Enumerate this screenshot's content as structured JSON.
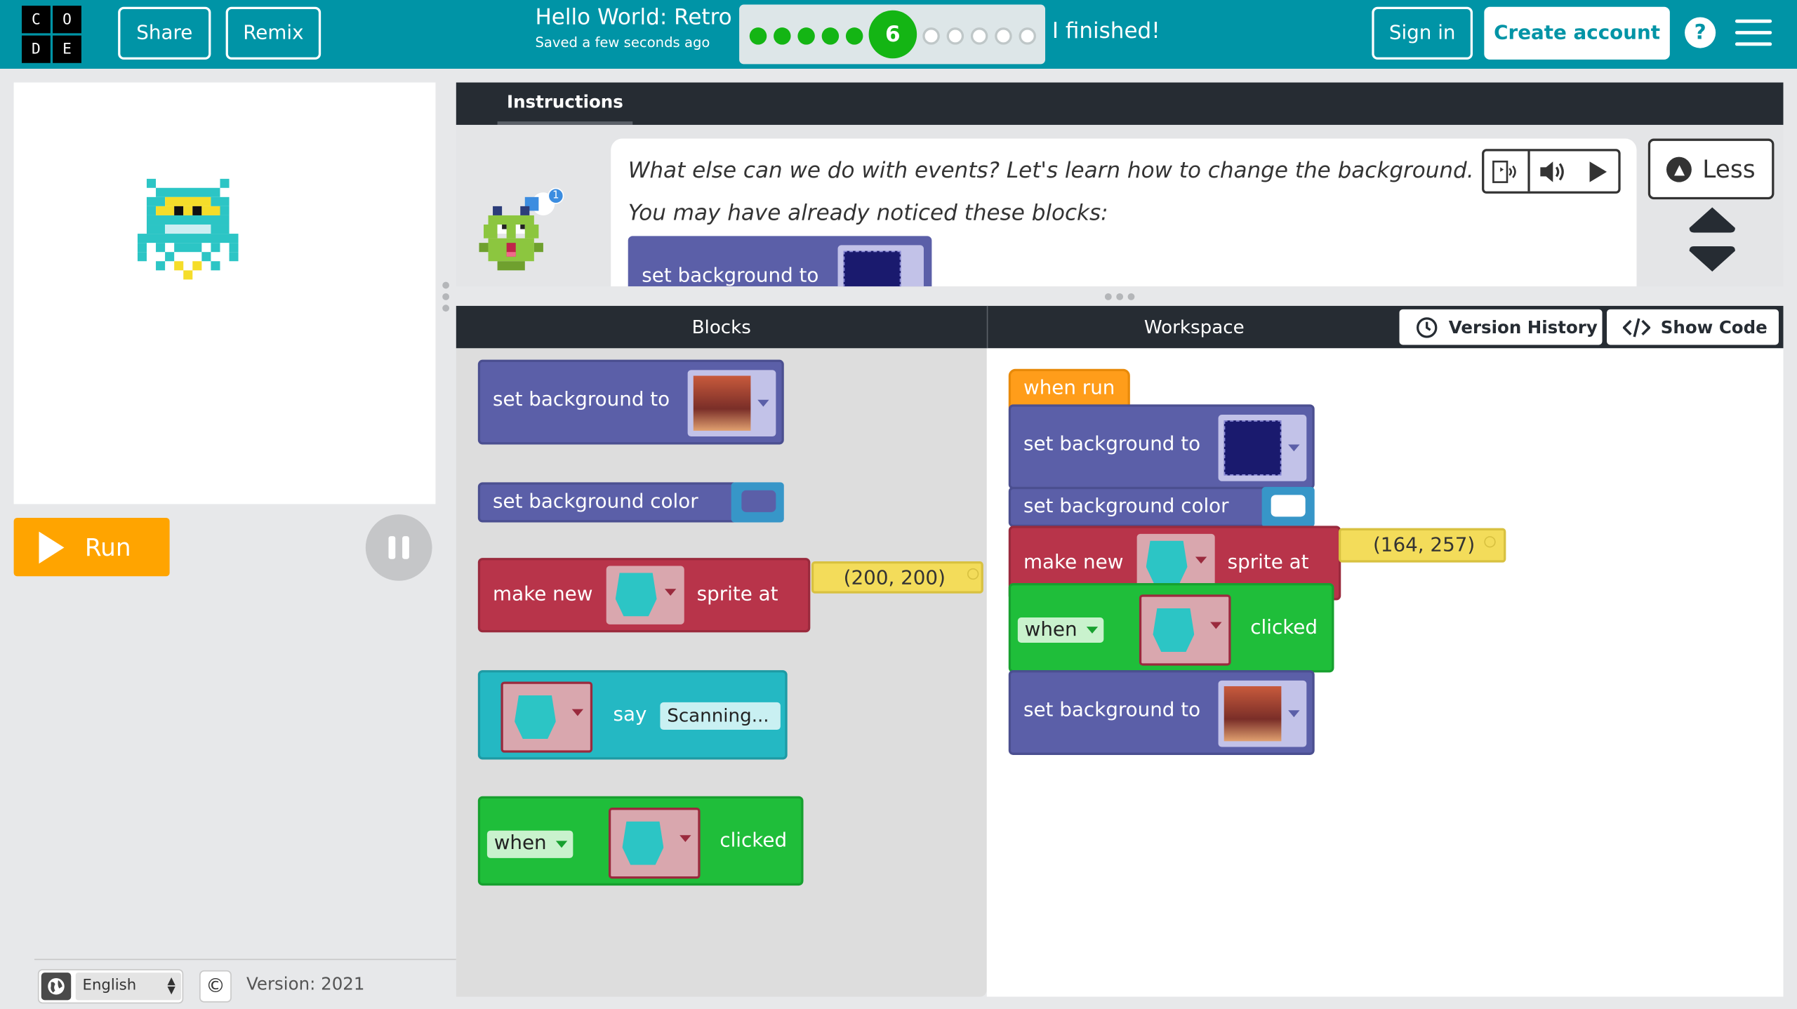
{
  "logo": {
    "letters": [
      "C",
      "O",
      "D",
      "E"
    ]
  },
  "header": {
    "share": "Share",
    "remix": "Remix",
    "title": "Hello World: Retro",
    "subtitle": "Saved a few seconds ago",
    "current_level": "6",
    "levels_done": 5,
    "levels_remaining": 5,
    "finished": "I finished!",
    "sign_in": "Sign in",
    "create_account": "Create account",
    "help": "?"
  },
  "left": {
    "run": "Run",
    "language": "English",
    "version": "Version: 2021",
    "copyright": "©"
  },
  "instructions": {
    "tab": "Instructions",
    "line1": "What else can we do with events? Let's learn how to change the background.",
    "line2": "You may have already noticed these blocks:",
    "block_preview": "set background to",
    "less": "Less",
    "badge": "1"
  },
  "panels": {
    "blocks": "Blocks",
    "workspace": "Workspace",
    "version_history": "Version History",
    "show_code": "Show Code"
  },
  "toolbox": {
    "b1": "set background to",
    "b2": "set background color",
    "b3_a": "make new",
    "b3_b": "sprite at",
    "b3_coord": "(200, 200)",
    "b4_say": "say",
    "b4_text": "Scanning...",
    "b5_when": "when",
    "b5_clicked": "clicked"
  },
  "workspace": {
    "when_run": "when run",
    "w1": "set background to",
    "w2": "set background color",
    "w3_a": "make new",
    "w3_b": "sprite at",
    "w3_coord": "(164, 257)",
    "w4_when": "when",
    "w4_clicked": "clicked",
    "w5": "set background to"
  },
  "colors": {
    "header": "#0094a6",
    "run": "#ffa400",
    "purple_block": "#5b5fa8",
    "red_block": "#b8344a",
    "teal_block": "#24b8c3",
    "green_block": "#1fbe3a",
    "orange_block": "#ff9d1a"
  }
}
